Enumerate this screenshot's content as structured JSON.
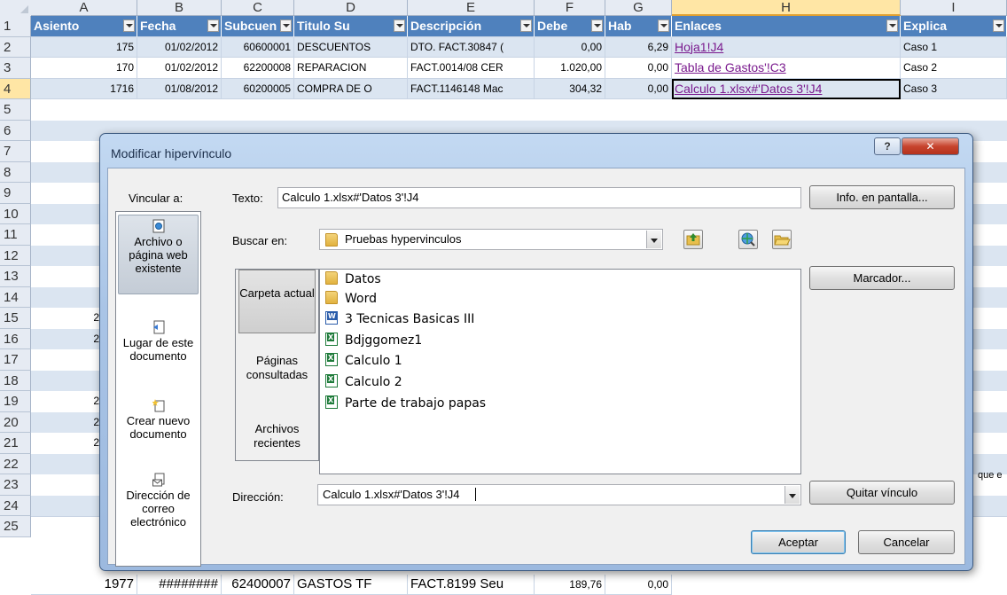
{
  "spreadsheet": {
    "columns": [
      "A",
      "B",
      "C",
      "D",
      "E",
      "F",
      "G",
      "H",
      "I"
    ],
    "selected_column": "H",
    "rows": [
      "1",
      "2",
      "3",
      "4",
      "5",
      "6",
      "7",
      "8",
      "9",
      "10",
      "11",
      "12",
      "13",
      "14",
      "15",
      "16",
      "17",
      "18",
      "19",
      "20",
      "21",
      "22",
      "23",
      "24",
      "25"
    ],
    "selected_row": "4",
    "headers": [
      "Asiento",
      "Fecha",
      "Subcuen",
      "Titulo Su",
      "Descripción",
      "Debe",
      "Hab",
      "Enlaces",
      "Explica"
    ],
    "data": [
      [
        "175",
        "01/02/2012",
        "60600001",
        "DESCUENTOS",
        "DTO. FACT.30847 (",
        "0,00",
        "6,29",
        "Hoja1!J4",
        "Caso 1"
      ],
      [
        "170",
        "01/02/2012",
        "62200008",
        "REPARACION",
        "FACT.0014/08 CER",
        "1.020,00",
        "0,00",
        "Tabla de Gastos'!C3",
        "Caso 2"
      ],
      [
        "1716",
        "01/08/2012",
        "60200005",
        "COMPRA DE O",
        "FACT.1146148 Mac",
        "304,32",
        "0,00",
        "Calculo 1.xlsx#'Datos 3'!J4",
        "Caso 3"
      ]
    ],
    "partial": {
      "row12": "",
      "row13": "2",
      "row14": "2",
      "row17": "2",
      "row18": "2",
      "row19": "2",
      "row20_right": "que e"
    },
    "last_row": [
      "1977",
      "########",
      "62400007",
      "GASTOS TF",
      "FACT.8199 Seu",
      "189,76",
      "0,00"
    ]
  },
  "dialog": {
    "title": "Modificar hipervínculo",
    "help_label": "?",
    "close_label": "✕",
    "link_to_label": "Vincular a:",
    "link_to_items": [
      {
        "label": "Archivo o página web existente",
        "icon": "file-web-icon"
      },
      {
        "label": "Lugar de este documento",
        "icon": "document-place-icon"
      },
      {
        "label": "Crear nuevo documento",
        "icon": "new-document-icon"
      },
      {
        "label": "Dirección de correo electrónico",
        "icon": "email-icon"
      }
    ],
    "text_label": "Texto:",
    "text_value": "Calculo 1.xlsx#'Datos 3'!J4",
    "screentip_button": "Info. en pantalla...",
    "lookin_label": "Buscar en:",
    "lookin_value": "Pruebas hypervinculos",
    "lookin_tabs": [
      "Carpeta actual",
      "Páginas consultadas",
      "Archivos recientes"
    ],
    "files": [
      {
        "name": "Datos",
        "type": "folder"
      },
      {
        "name": "Word",
        "type": "folder"
      },
      {
        "name": "3 Tecnicas Basicas III",
        "type": "word"
      },
      {
        "name": "Bdjggomez1",
        "type": "excel"
      },
      {
        "name": "Calculo 1",
        "type": "excel"
      },
      {
        "name": "Calculo 2",
        "type": "excel"
      },
      {
        "name": "Parte de trabajo papas",
        "type": "excel"
      }
    ],
    "bookmark_button": "Marcador...",
    "address_label": "Dirección:",
    "address_value": "Calculo 1.xlsx#'Datos 3'!J4",
    "remove_link_button": "Quitar vínculo",
    "ok_button": "Aceptar",
    "cancel_button": "Cancelar"
  }
}
